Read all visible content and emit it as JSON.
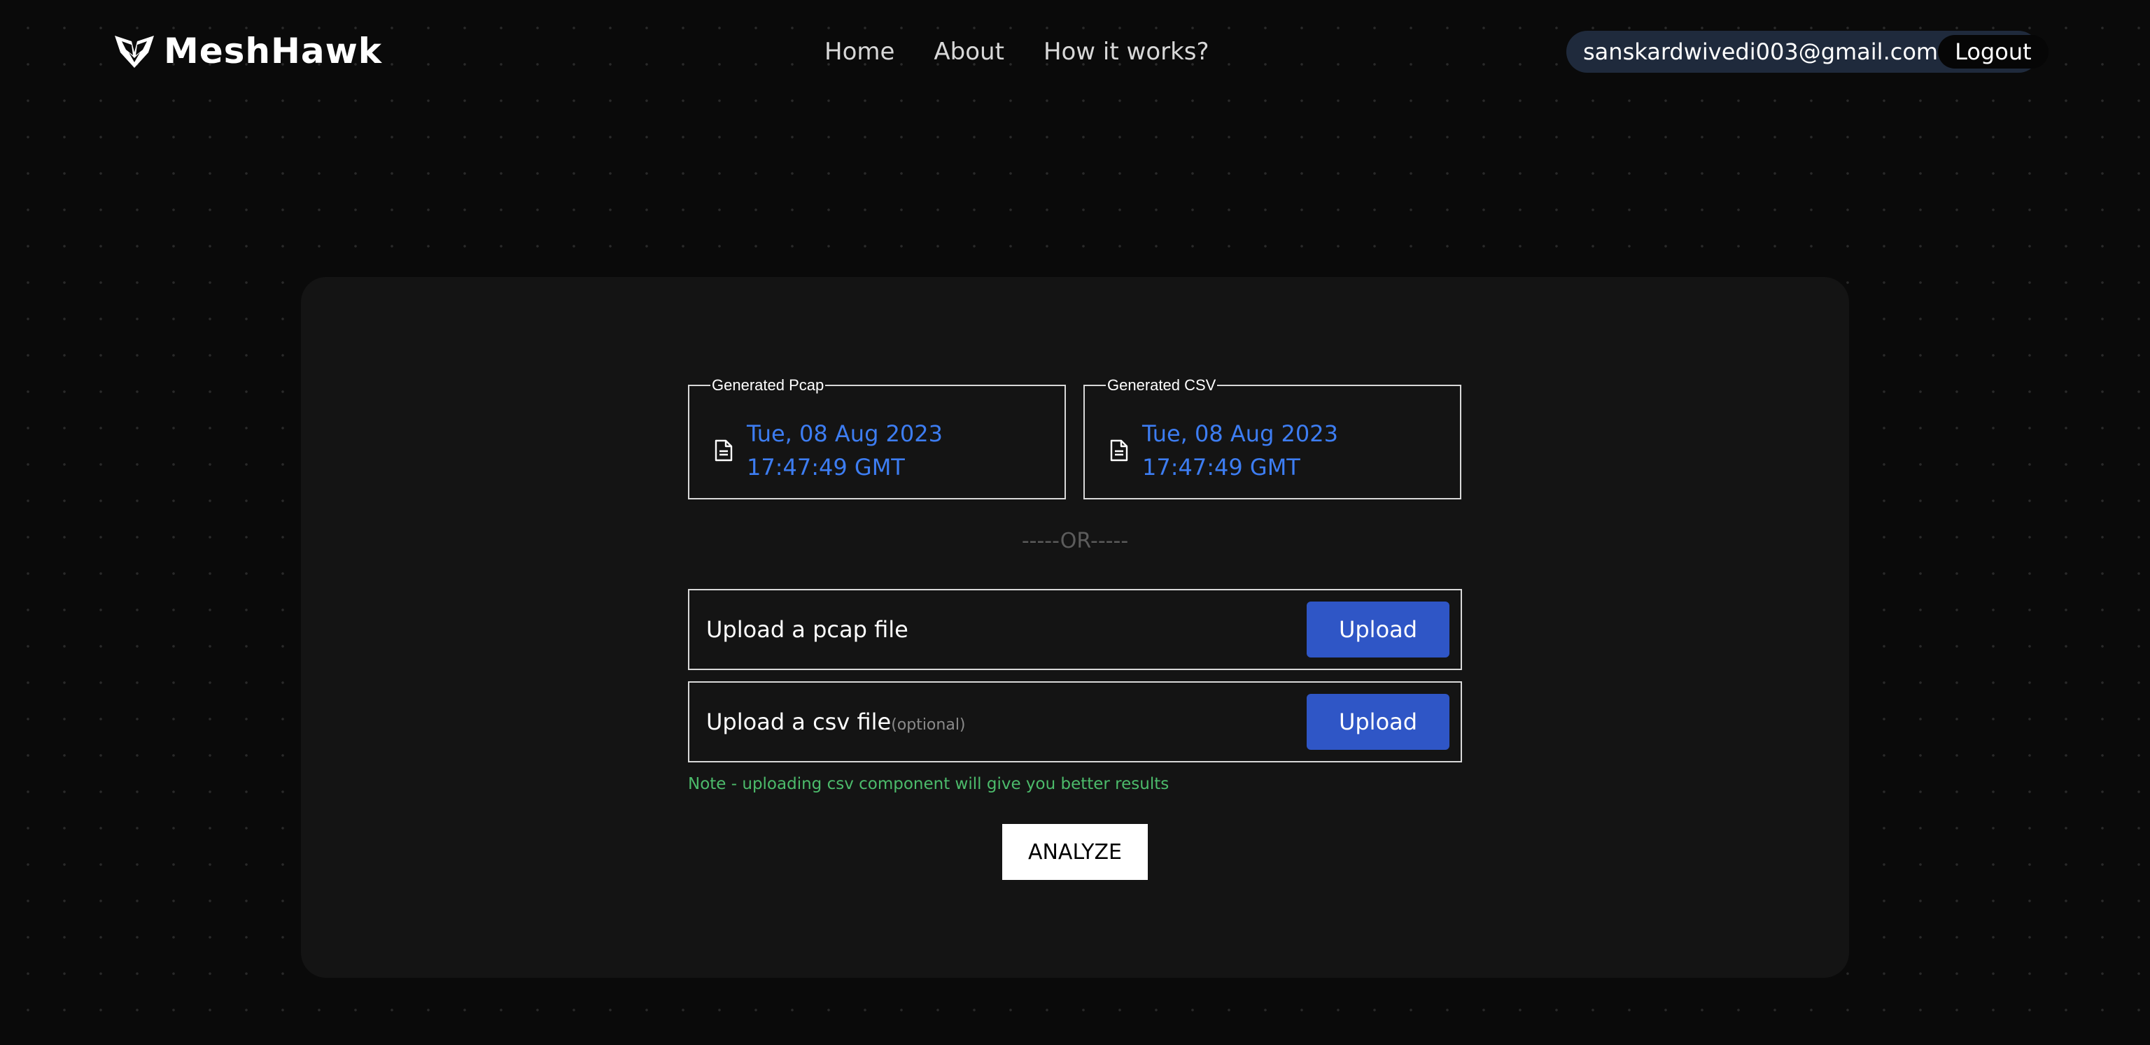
{
  "header": {
    "brand": "MeshHawk",
    "nav": [
      {
        "label": "Home"
      },
      {
        "label": "About"
      },
      {
        "label": "How it works?"
      }
    ],
    "user_email": "sanskardwivedi003@gmail.com",
    "logout_label": "Logout"
  },
  "generated": {
    "pcap": {
      "legend": "Generated Pcap",
      "timestamp": "Tue, 08 Aug 2023 17:47:49 GMT"
    },
    "csv": {
      "legend": "Generated CSV",
      "timestamp": "Tue, 08 Aug 2023 17:47:49 GMT"
    }
  },
  "separator": "-----OR-----",
  "uploads": {
    "pcap": {
      "label": "Upload a pcap file",
      "button": "Upload"
    },
    "csv": {
      "label": "Upload a csv file",
      "optional": "(optional)",
      "button": "Upload"
    }
  },
  "note": "Note - uploading csv component will give you better results",
  "analyze_label": "ANALYZE",
  "colors": {
    "background": "#0a0a0a",
    "panel": "#141414",
    "link_blue": "#3d7df2",
    "upload_button": "#2f56c6",
    "note_green": "#4cbb6b",
    "user_pill": "#1f2a3c"
  },
  "icons": {
    "logo": "hawk-shield-icon",
    "file": "document-icon"
  }
}
